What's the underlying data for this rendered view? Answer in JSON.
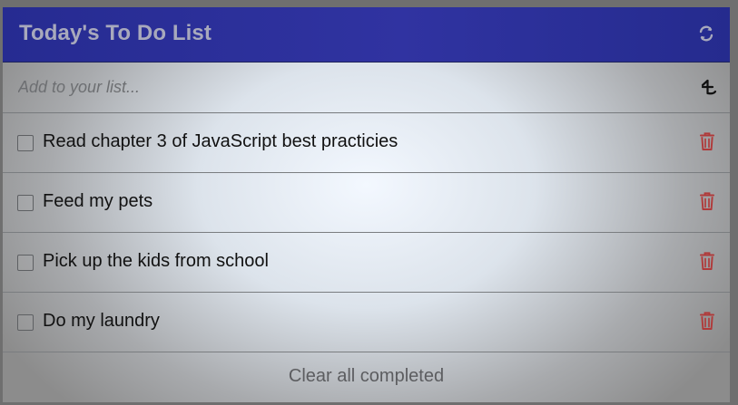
{
  "header": {
    "title": "Today's To Do List",
    "refresh_icon": "refresh-icon"
  },
  "add_form": {
    "placeholder": "Add to your list...",
    "add_icon": "add-icon"
  },
  "todos": [
    {
      "label": "Read chapter 3 of JavaScript best practicies",
      "completed": false,
      "delete_icon": "trash-icon"
    },
    {
      "label": "Feed my pets",
      "completed": false,
      "delete_icon": "trash-icon"
    },
    {
      "label": "Pick up the kids from school",
      "completed": false,
      "delete_icon": "trash-icon"
    },
    {
      "label": "Do my laundry",
      "completed": false,
      "delete_icon": "trash-icon"
    }
  ],
  "footer": {
    "clear_label": "Clear all completed"
  },
  "colors": {
    "header_bg": "#3033a1",
    "title_text": "#a8a9bc",
    "delete_red": "#b03a3a",
    "footer_text": "#5c5d60"
  }
}
